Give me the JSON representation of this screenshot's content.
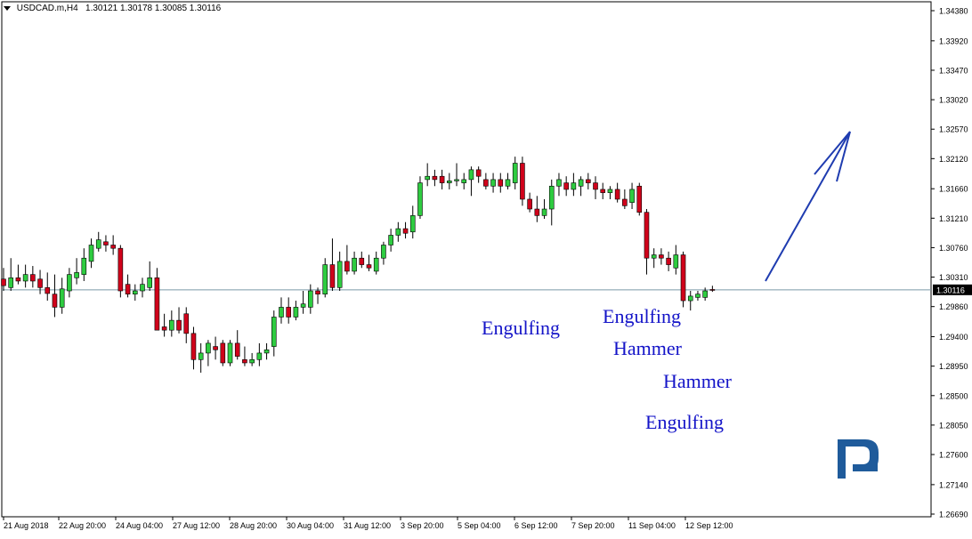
{
  "header": {
    "symbol": "USDCAD.m,H4",
    "ohlc": "1.30121 1.30178 1.30085 1.30116"
  },
  "colors": {
    "bull": "#2ecc40",
    "bear": "#d0021b",
    "wick": "#000000",
    "price_line": "#7a9aa8",
    "annotation": "#1414c8",
    "arrow": "#1f3cb0",
    "logo": "#1f5b9b"
  },
  "y_axis": {
    "ticks": [
      "1.34380",
      "1.33920",
      "1.33470",
      "1.33020",
      "1.32570",
      "1.32120",
      "1.31660",
      "1.31210",
      "1.30760",
      "1.30310",
      "1.29860",
      "1.29400",
      "1.28950",
      "1.28500",
      "1.28050",
      "1.27600",
      "1.27140",
      "1.26690"
    ],
    "current_price": "1.30116",
    "ylim": [
      1.2669,
      1.3438
    ]
  },
  "x_axis": {
    "labels": [
      "21 Aug 2018",
      "22 Aug 20:00",
      "24 Aug 04:00",
      "27 Aug 12:00",
      "28 Aug 20:00",
      "30 Aug 04:00",
      "31 Aug 12:00",
      "3 Sep 20:00",
      "5 Sep 04:00",
      "6 Sep 12:00",
      "7 Sep 20:00",
      "11 Sep 04:00",
      "12 Sep 12:00"
    ]
  },
  "annotations": [
    {
      "text": "Engulfing"
    },
    {
      "text": "Engulfing"
    },
    {
      "text": "Hammer"
    },
    {
      "text": "Hammer"
    },
    {
      "text": "Engulfing"
    }
  ],
  "chart_data": {
    "type": "candlestick",
    "symbol": "USDCAD.m",
    "timeframe": "H4",
    "ylim": [
      1.2669,
      1.3438
    ],
    "candles": [
      {
        "o": 1.3028,
        "h": 1.3045,
        "l": 1.301,
        "c": 1.3018
      },
      {
        "o": 1.3015,
        "h": 1.306,
        "l": 1.301,
        "c": 1.303
      },
      {
        "o": 1.303,
        "h": 1.305,
        "l": 1.302,
        "c": 1.3025
      },
      {
        "o": 1.3025,
        "h": 1.305,
        "l": 1.3015,
        "c": 1.3035
      },
      {
        "o": 1.3035,
        "h": 1.3048,
        "l": 1.3015,
        "c": 1.3025
      },
      {
        "o": 1.3028,
        "h": 1.3042,
        "l": 1.3005,
        "c": 1.3015
      },
      {
        "o": 1.3015,
        "h": 1.3038,
        "l": 1.2995,
        "c": 1.3006
      },
      {
        "o": 1.3005,
        "h": 1.3035,
        "l": 1.297,
        "c": 1.2985
      },
      {
        "o": 1.2985,
        "h": 1.303,
        "l": 1.2975,
        "c": 1.3013
      },
      {
        "o": 1.301,
        "h": 1.3045,
        "l": 1.3,
        "c": 1.3035
      },
      {
        "o": 1.303,
        "h": 1.306,
        "l": 1.302,
        "c": 1.3038
      },
      {
        "o": 1.3035,
        "h": 1.3075,
        "l": 1.3025,
        "c": 1.306
      },
      {
        "o": 1.3055,
        "h": 1.309,
        "l": 1.3045,
        "c": 1.308
      },
      {
        "o": 1.3075,
        "h": 1.31,
        "l": 1.307,
        "c": 1.3088
      },
      {
        "o": 1.3085,
        "h": 1.3095,
        "l": 1.307,
        "c": 1.308
      },
      {
        "o": 1.308,
        "h": 1.3095,
        "l": 1.3065,
        "c": 1.3075
      },
      {
        "o": 1.3075,
        "h": 1.308,
        "l": 1.3,
        "c": 1.301
      },
      {
        "o": 1.302,
        "h": 1.3035,
        "l": 1.3,
        "c": 1.3005
      },
      {
        "o": 1.3005,
        "h": 1.302,
        "l": 1.2995,
        "c": 1.301
      },
      {
        "o": 1.301,
        "h": 1.303,
        "l": 1.3,
        "c": 1.302
      },
      {
        "o": 1.3015,
        "h": 1.3055,
        "l": 1.301,
        "c": 1.303
      },
      {
        "o": 1.303,
        "h": 1.3045,
        "l": 1.3,
        "c": 1.295
      },
      {
        "o": 1.2955,
        "h": 1.2975,
        "l": 1.294,
        "c": 1.295
      },
      {
        "o": 1.295,
        "h": 1.298,
        "l": 1.294,
        "c": 1.2965
      },
      {
        "o": 1.2965,
        "h": 1.2985,
        "l": 1.2945,
        "c": 1.295
      },
      {
        "o": 1.2975,
        "h": 1.2985,
        "l": 1.293,
        "c": 1.2945
      },
      {
        "o": 1.2945,
        "h": 1.2955,
        "l": 1.289,
        "c": 1.2905
      },
      {
        "o": 1.2905,
        "h": 1.293,
        "l": 1.2885,
        "c": 1.2915
      },
      {
        "o": 1.2915,
        "h": 1.2935,
        "l": 1.2895,
        "c": 1.293
      },
      {
        "o": 1.2925,
        "h": 1.294,
        "l": 1.2905,
        "c": 1.292
      },
      {
        "o": 1.293,
        "h": 1.2935,
        "l": 1.2895,
        "c": 1.29
      },
      {
        "o": 1.29,
        "h": 1.2935,
        "l": 1.2895,
        "c": 1.293
      },
      {
        "o": 1.293,
        "h": 1.295,
        "l": 1.2905,
        "c": 1.291
      },
      {
        "o": 1.2905,
        "h": 1.2925,
        "l": 1.2895,
        "c": 1.29
      },
      {
        "o": 1.29,
        "h": 1.2915,
        "l": 1.2895,
        "c": 1.2905
      },
      {
        "o": 1.2905,
        "h": 1.293,
        "l": 1.2895,
        "c": 1.2915
      },
      {
        "o": 1.2915,
        "h": 1.293,
        "l": 1.2905,
        "c": 1.292
      },
      {
        "o": 1.2925,
        "h": 1.298,
        "l": 1.291,
        "c": 1.297
      },
      {
        "o": 1.297,
        "h": 1.3,
        "l": 1.296,
        "c": 1.2985
      },
      {
        "o": 1.2985,
        "h": 1.3,
        "l": 1.296,
        "c": 1.297
      },
      {
        "o": 1.297,
        "h": 1.2995,
        "l": 1.2965,
        "c": 1.2985
      },
      {
        "o": 1.2985,
        "h": 1.301,
        "l": 1.2975,
        "c": 1.299
      },
      {
        "o": 1.2985,
        "h": 1.302,
        "l": 1.2975,
        "c": 1.301
      },
      {
        "o": 1.301,
        "h": 1.3015,
        "l": 1.299,
        "c": 1.3005
      },
      {
        "o": 1.3005,
        "h": 1.306,
        "l": 1.3,
        "c": 1.305
      },
      {
        "o": 1.305,
        "h": 1.309,
        "l": 1.301,
        "c": 1.3015
      },
      {
        "o": 1.3015,
        "h": 1.307,
        "l": 1.301,
        "c": 1.3055
      },
      {
        "o": 1.3055,
        "h": 1.308,
        "l": 1.3035,
        "c": 1.304
      },
      {
        "o": 1.304,
        "h": 1.307,
        "l": 1.3035,
        "c": 1.306
      },
      {
        "o": 1.306,
        "h": 1.307,
        "l": 1.3045,
        "c": 1.305
      },
      {
        "o": 1.305,
        "h": 1.3065,
        "l": 1.304,
        "c": 1.3045
      },
      {
        "o": 1.304,
        "h": 1.307,
        "l": 1.3035,
        "c": 1.306
      },
      {
        "o": 1.306,
        "h": 1.3085,
        "l": 1.305,
        "c": 1.308
      },
      {
        "o": 1.308,
        "h": 1.3105,
        "l": 1.307,
        "c": 1.3095
      },
      {
        "o": 1.3095,
        "h": 1.3115,
        "l": 1.3085,
        "c": 1.3105
      },
      {
        "o": 1.3105,
        "h": 1.3115,
        "l": 1.309,
        "c": 1.3098
      },
      {
        "o": 1.31,
        "h": 1.314,
        "l": 1.309,
        "c": 1.3125
      },
      {
        "o": 1.3125,
        "h": 1.3185,
        "l": 1.312,
        "c": 1.3175
      },
      {
        "o": 1.318,
        "h": 1.3205,
        "l": 1.317,
        "c": 1.3185
      },
      {
        "o": 1.3185,
        "h": 1.3195,
        "l": 1.317,
        "c": 1.318
      },
      {
        "o": 1.3185,
        "h": 1.3195,
        "l": 1.3165,
        "c": 1.3175
      },
      {
        "o": 1.3175,
        "h": 1.319,
        "l": 1.3165,
        "c": 1.3178
      },
      {
        "o": 1.3178,
        "h": 1.3205,
        "l": 1.317,
        "c": 1.318
      },
      {
        "o": 1.3175,
        "h": 1.319,
        "l": 1.3165,
        "c": 1.318
      },
      {
        "o": 1.318,
        "h": 1.32,
        "l": 1.3155,
        "c": 1.3195
      },
      {
        "o": 1.3195,
        "h": 1.32,
        "l": 1.3175,
        "c": 1.3185
      },
      {
        "o": 1.318,
        "h": 1.319,
        "l": 1.3165,
        "c": 1.317
      },
      {
        "o": 1.317,
        "h": 1.319,
        "l": 1.316,
        "c": 1.318
      },
      {
        "o": 1.318,
        "h": 1.319,
        "l": 1.316,
        "c": 1.317
      },
      {
        "o": 1.317,
        "h": 1.319,
        "l": 1.3165,
        "c": 1.318
      },
      {
        "o": 1.3175,
        "h": 1.3215,
        "l": 1.3165,
        "c": 1.3205
      },
      {
        "o": 1.3205,
        "h": 1.3215,
        "l": 1.314,
        "c": 1.315
      },
      {
        "o": 1.315,
        "h": 1.316,
        "l": 1.313,
        "c": 1.3135
      },
      {
        "o": 1.3135,
        "h": 1.3155,
        "l": 1.3115,
        "c": 1.3125
      },
      {
        "o": 1.3125,
        "h": 1.315,
        "l": 1.312,
        "c": 1.3135
      },
      {
        "o": 1.3135,
        "h": 1.318,
        "l": 1.311,
        "c": 1.317
      },
      {
        "o": 1.317,
        "h": 1.319,
        "l": 1.3155,
        "c": 1.318
      },
      {
        "o": 1.3175,
        "h": 1.3185,
        "l": 1.3155,
        "c": 1.3165
      },
      {
        "o": 1.3165,
        "h": 1.319,
        "l": 1.3155,
        "c": 1.3175
      },
      {
        "o": 1.317,
        "h": 1.3185,
        "l": 1.3155,
        "c": 1.318
      },
      {
        "o": 1.318,
        "h": 1.319,
        "l": 1.3165,
        "c": 1.3175
      },
      {
        "o": 1.3175,
        "h": 1.3185,
        "l": 1.315,
        "c": 1.3165
      },
      {
        "o": 1.3165,
        "h": 1.3175,
        "l": 1.315,
        "c": 1.316
      },
      {
        "o": 1.316,
        "h": 1.317,
        "l": 1.315,
        "c": 1.3165
      },
      {
        "o": 1.3165,
        "h": 1.3175,
        "l": 1.3145,
        "c": 1.315
      },
      {
        "o": 1.315,
        "h": 1.3165,
        "l": 1.3135,
        "c": 1.314
      },
      {
        "o": 1.3145,
        "h": 1.3175,
        "l": 1.3135,
        "c": 1.3165
      },
      {
        "o": 1.317,
        "h": 1.3175,
        "l": 1.3125,
        "c": 1.313
      },
      {
        "o": 1.313,
        "h": 1.3135,
        "l": 1.3035,
        "c": 1.306
      },
      {
        "o": 1.306,
        "h": 1.3075,
        "l": 1.3045,
        "c": 1.3065
      },
      {
        "o": 1.3065,
        "h": 1.3075,
        "l": 1.305,
        "c": 1.306
      },
      {
        "o": 1.306,
        "h": 1.307,
        "l": 1.304,
        "c": 1.305
      },
      {
        "o": 1.3045,
        "h": 1.308,
        "l": 1.3035,
        "c": 1.3065
      },
      {
        "o": 1.3065,
        "h": 1.307,
        "l": 1.2985,
        "c": 1.2995
      },
      {
        "o": 1.2995,
        "h": 1.301,
        "l": 1.298,
        "c": 1.3002
      },
      {
        "o": 1.3,
        "h": 1.301,
        "l": 1.2995,
        "c": 1.3005
      },
      {
        "o": 1.3,
        "h": 1.3015,
        "l": 1.2995,
        "c": 1.301
      },
      {
        "o": 1.30121,
        "h": 1.30178,
        "l": 1.30085,
        "c": 1.30116
      }
    ]
  }
}
